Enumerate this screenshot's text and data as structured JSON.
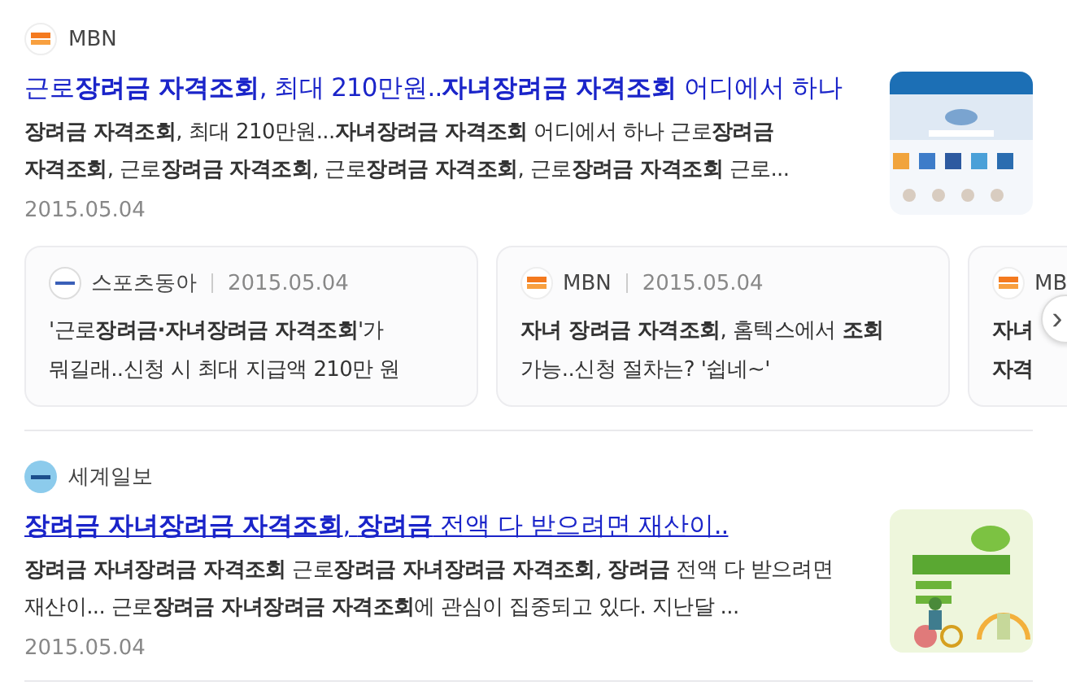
{
  "results": [
    {
      "source": "MBN",
      "logo": {
        "kind": "mbn"
      },
      "title": "근로**장려금 자격조회**, 최대 210만원..**자녀장려금 자격조회** 어디에서 하나",
      "underlined": false,
      "snippet": "**장려금 자격조회**, 최대 210만원...**자녀장려금 자격조회** 어디에서 하나 근로**장려금 자격조회**, 근로**장려금 자격조회**, 근로**장려금 자격조회**, 근로**장려금 자격조회** 근로...",
      "date": "2015.05.04",
      "related": [
        {
          "source": "스포츠동아",
          "logo": {
            "kind": "sports"
          },
          "date": "2015.05.04",
          "title": "'근로**장려금·자녀장려금 자격조회**'가 뭐길래..신청 시 최대 지급액 210만 원"
        },
        {
          "source": "MBN",
          "logo": {
            "kind": "mbn"
          },
          "date": "2015.05.04",
          "title": "**자녀 장려금 자격조회**, 홈텍스에서 **조회** 가능..신청 절차는? '쉽네~'"
        },
        {
          "source": "MB",
          "logo": {
            "kind": "mbn"
          },
          "title": "**자녀**\n**자격**"
        }
      ],
      "next_button": "›"
    },
    {
      "source": "세계일보",
      "logo": {
        "kind": "segye"
      },
      "title": "**장려금 자녀장려금 자격조회**, **장려금** 전액 다 받으려면 재산이..",
      "underlined": true,
      "snippet": "**장려금 자녀장려금 자격조회** 근로**장려금 자녀장려금 자격조회**, **장려금** 전액 다 받으려면 재산이... 근로**장려금 자녀장려금 자격조회**에 관심이 집중되고 있다. 지난달 ...",
      "date": "2015.05.04"
    }
  ]
}
